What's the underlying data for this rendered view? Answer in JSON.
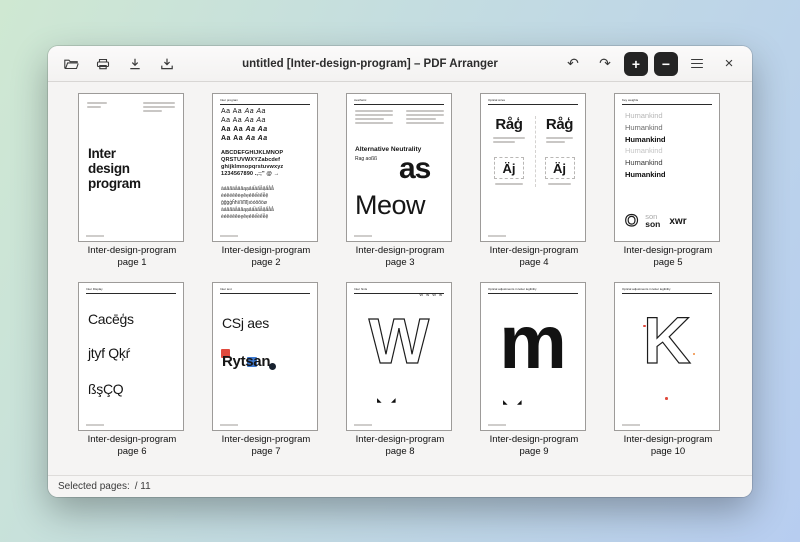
{
  "window_title": "untitled [Inter-design-program] – PDF Arranger",
  "statusbar": {
    "selected_label": "Selected pages:",
    "selected_value": "/ 11"
  },
  "glyphs": {
    "undo": "↶",
    "redo": "↷",
    "zoom_in": "+",
    "zoom_out": "−",
    "close": "×",
    "mark": "◣",
    "mark2": "◢"
  },
  "captions": [
    {
      "l1": "Inter-design-program",
      "l2": "page 1"
    },
    {
      "l1": "Inter-design-program",
      "l2": "page 2"
    },
    {
      "l1": "Inter-design-program",
      "l2": "page 3"
    },
    {
      "l1": "Inter-design-program",
      "l2": "page 4"
    },
    {
      "l1": "Inter-design-program",
      "l2": "page 5"
    },
    {
      "l1": "Inter-design-program",
      "l2": "page 6"
    },
    {
      "l1": "Inter-design-program",
      "l2": "page 7"
    },
    {
      "l1": "Inter-design-program",
      "l2": "page 8"
    },
    {
      "l1": "Inter-design-program",
      "l2": "page 9"
    },
    {
      "l1": "Inter-design-program",
      "l2": "page 10"
    }
  ],
  "thumbs": {
    "p1": {
      "t1": "Inter",
      "t2": "design",
      "t3": "program",
      "header": "Inter design program"
    },
    "p2": {
      "header": "Inter program",
      "aa": "Aa Aa",
      "aai": "Aa Aa",
      "a1": "ABCDEFGHIJKLMNOP",
      "a2": "QRSTUVWXYZabcdef",
      "a3": "ghijklmnopqrstuvwxyz",
      "a4": "1234567890 .,:;\" @ →",
      "c1": "àáâãäåāăąạảấầẩẫậắằẳ",
      "c2": "èéêëēĕėęěẹẻẽếềểễệ",
      "c3": "ĝğġģĥħìíîïĩīĭįıòóôõöø"
    },
    "p3": {
      "header": "Aesthetic",
      "title": "Alternative Neutrality",
      "sub": "Rag aoßß",
      "big": "as",
      "big2": "Meow"
    },
    "p4": {
      "header": "Optical sizes",
      "g1": "Råģ",
      "g2": "Råģ",
      "b1": "Äj",
      "b2": "Äj"
    },
    "p5": {
      "header": "Key weights",
      "w": "Humankind",
      "o": "O",
      "son1": "son",
      "son2": "son",
      "xwr": "xwr"
    },
    "p6": {
      "header": "Inter Display",
      "l1": "Cacēģs",
      "l2": "jtyf Qķŕ",
      "l3": "ßşÇQ"
    },
    "p7": {
      "header": "Inter text",
      "l1": "CSj aes",
      "l2": "Rytsan"
    },
    "p8": {
      "header": "Inter hints",
      "tiny": "W w  W w",
      "g": "W"
    },
    "p9": {
      "header": "Optical adjustments in letter legibility",
      "g": "m"
    },
    "p10": {
      "header": "Optical adjustments in letter legibility",
      "g": "K"
    }
  }
}
